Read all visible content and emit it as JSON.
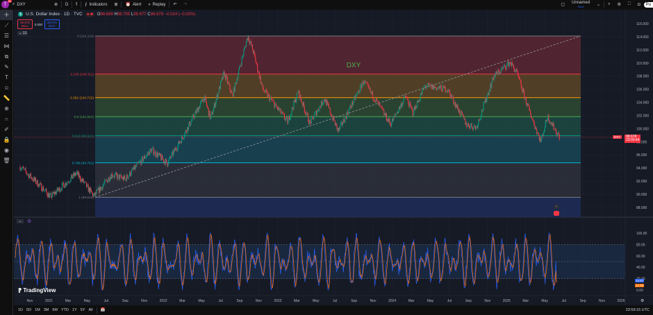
{
  "topbar": {
    "avatar_letter": "T",
    "notif_count": "11",
    "symbol": "DXY",
    "interval": "D",
    "indicators": "Indicators",
    "alert": "Alert",
    "replay": "Replay",
    "layout_name": "Unnamed",
    "layout_status": "Save",
    "publish": "Pu"
  },
  "legend": {
    "title": "U.S. Dollar Index · 1D · TVC",
    "o_label": "O",
    "o": "98.699",
    "h_label": "H",
    "h": "98.705",
    "l_label": "L",
    "l": "98.677",
    "c_label": "C",
    "c": "98.678",
    "change": "−0.024 (−0.02%)"
  },
  "trade": {
    "sell_price": "98.678",
    "sell_label": "SELL",
    "spread": "0.000",
    "buy_price": "98.678",
    "buy_label": "BUY",
    "collapse_count": "13"
  },
  "chart_data": {
    "type": "candlestick",
    "symbol": "DXY",
    "annotation": "DXY",
    "ylim": [
      87,
      117
    ],
    "y_ticks": [
      116,
      114,
      112,
      110,
      108,
      106,
      104,
      102,
      100,
      98,
      96,
      94,
      92,
      90,
      88
    ],
    "x_ticks": [
      "Nov",
      "2021",
      "Mar",
      "May",
      "Jul",
      "Sep",
      "Nov",
      "2022",
      "Mar",
      "May",
      "Jul",
      "Sep",
      "Nov",
      "2023",
      "Mar",
      "May",
      "Jul",
      "Sep",
      "Nov",
      "2024",
      "Mar",
      "May",
      "Jul",
      "Sep",
      "Nov",
      "2025",
      "Mar",
      "May",
      "Jul",
      "Sep",
      "Nov",
      "2026"
    ],
    "waypoints": [
      [
        "2020-10-01",
        94.2
      ],
      [
        "2020-12-10",
        91
      ],
      [
        "2021-01-06",
        89.6
      ],
      [
        "2021-03-30",
        93.2
      ],
      [
        "2021-05-25",
        89.7
      ],
      [
        "2021-07-20",
        93
      ],
      [
        "2021-09-01",
        92.3
      ],
      [
        "2021-11-24",
        96.8
      ],
      [
        "2022-01-14",
        94.7
      ],
      [
        "2022-03-07",
        99
      ],
      [
        "2022-05-12",
        104.8
      ],
      [
        "2022-06-01",
        101.5
      ],
      [
        "2022-07-14",
        108.5
      ],
      [
        "2022-08-10",
        105
      ],
      [
        "2022-09-28",
        114.1
      ],
      [
        "2022-10-14",
        112
      ],
      [
        "2022-11-15",
        106
      ],
      [
        "2023-01-10",
        102.5
      ],
      [
        "2023-02-02",
        101
      ],
      [
        "2023-03-08",
        105.6
      ],
      [
        "2023-04-14",
        100.8
      ],
      [
        "2023-05-31",
        104.6
      ],
      [
        "2023-07-14",
        99.6
      ],
      [
        "2023-10-03",
        107.2
      ],
      [
        "2023-12-28",
        100.7
      ],
      [
        "2024-02-14",
        104.9
      ],
      [
        "2024-03-08",
        102.4
      ],
      [
        "2024-04-16",
        106.5
      ],
      [
        "2024-06-26",
        106
      ],
      [
        "2024-08-27",
        100.6
      ],
      [
        "2024-09-27",
        100.2
      ],
      [
        "2024-11-22",
        108
      ],
      [
        "2025-01-13",
        110.1
      ],
      [
        "2025-02-03",
        108.5
      ],
      [
        "2025-03-10",
        103.4
      ],
      [
        "2025-04-21",
        98
      ],
      [
        "2025-05-12",
        101.9
      ],
      [
        "2025-06-20",
        98.678
      ]
    ],
    "fib": {
      "levels": [
        {
          "ratio": "0",
          "price": "114.113",
          "label": "0 (114.113)",
          "color": "#787b86"
        },
        {
          "ratio": "0.236",
          "price": "108.311",
          "label": "0.236 (108.311)",
          "color": "#f23645"
        },
        {
          "ratio": "0.382",
          "price": "104.722",
          "label": "0.382 (104.722)",
          "color": "#ff9800"
        },
        {
          "ratio": "0.5",
          "price": "101.821",
          "label": "0.5 (101.821)",
          "color": "#4caf50"
        },
        {
          "ratio": "0.618",
          "price": "98.921",
          "label": "0.618 (98.921)",
          "color": "#089981"
        },
        {
          "ratio": "0.786",
          "price": "94.791",
          "label": "0.786 (94.791)",
          "color": "#00bcd4"
        },
        {
          "ratio": "1",
          "price": "89.530",
          "label": "1 (89.530)",
          "color": "#787b86"
        }
      ]
    },
    "last_price": "98.678",
    "countdown": "23:00:44",
    "oscillator": {
      "ylim": [
        0,
        100
      ],
      "y_ticks": [
        "100.00",
        "80.00",
        "60.00",
        "40.00",
        "20.00",
        "0.00"
      ],
      "k": "14.67",
      "d": "12.93",
      "k_color": "#2962ff",
      "d_color": "#ff6d00"
    }
  },
  "bottombar": {
    "ranges": [
      "1D",
      "5D",
      "1M",
      "3M",
      "6M",
      "YTD",
      "1Y",
      "5Y",
      "All"
    ],
    "clock": "23:59:15 UTC"
  },
  "watermark": "TradingView"
}
